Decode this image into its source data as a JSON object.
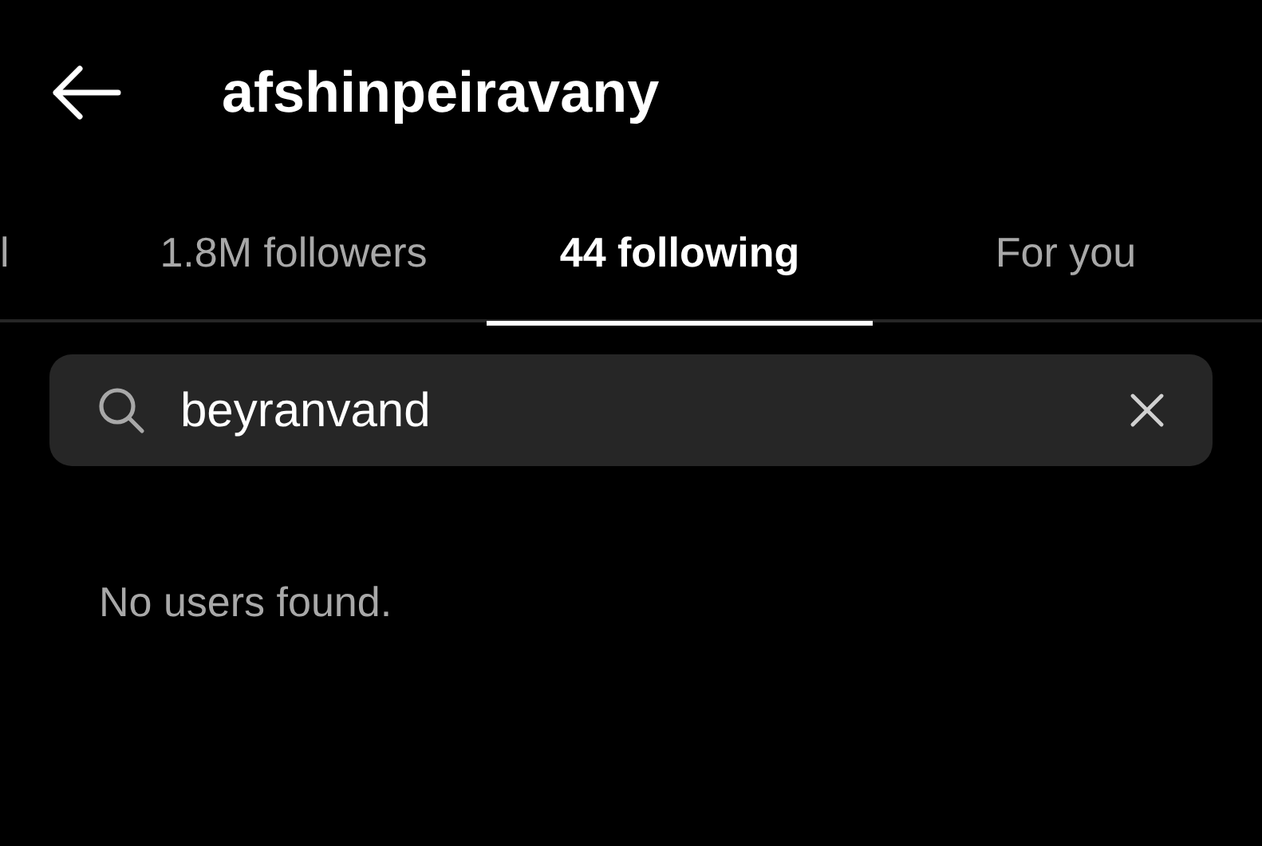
{
  "header": {
    "title": "afshinpeiravany"
  },
  "tabs": [
    {
      "label": "l",
      "selected": false
    },
    {
      "label": "1.8M followers",
      "selected": false
    },
    {
      "label": "44 following",
      "selected": true
    },
    {
      "label": "For you",
      "selected": false
    }
  ],
  "search": {
    "value": "beyranvand"
  },
  "message": "No users found."
}
